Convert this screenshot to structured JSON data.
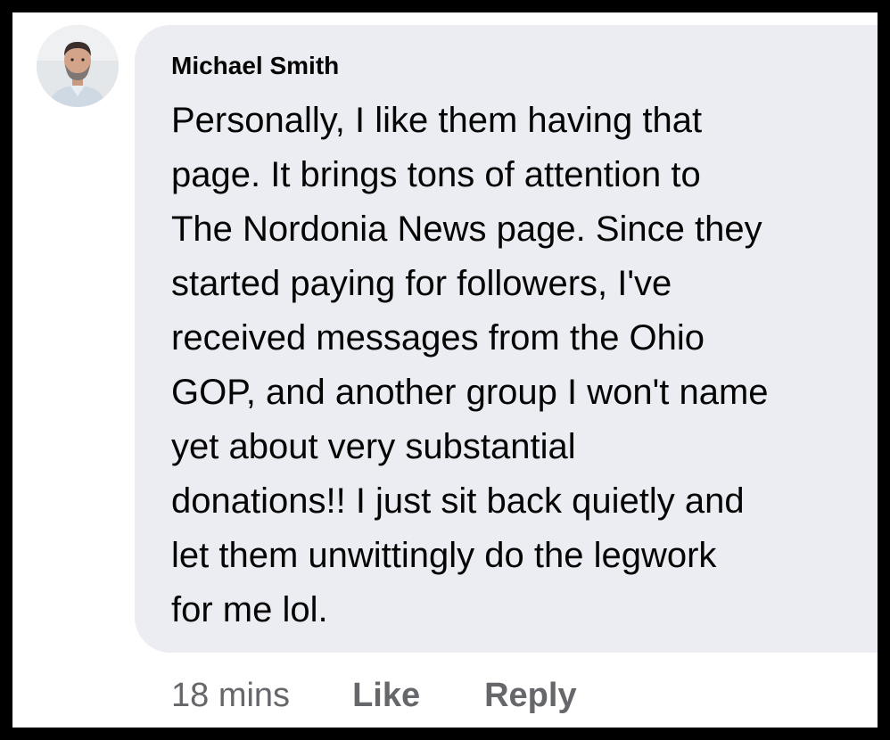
{
  "comment": {
    "author": "Michael Smith",
    "avatar": "profile-photo",
    "text_lines": [
      "Personally, I like them having that",
      "page. It brings tons of attention to",
      "The Nordonia News page. Since they",
      "started paying for followers, I've",
      "received messages from the Ohio",
      "GOP, and another group I won't name",
      "yet about very substantial",
      "donations!! I just sit back quietly and",
      "let them unwittingly do the legwork",
      "for me lol."
    ],
    "timestamp": "18 mins",
    "like_label": "Like",
    "reply_label": "Reply"
  },
  "colors": {
    "bubble": "#ecedf2",
    "text": "#050505",
    "meta": "#65676b",
    "frame": "#000000"
  }
}
